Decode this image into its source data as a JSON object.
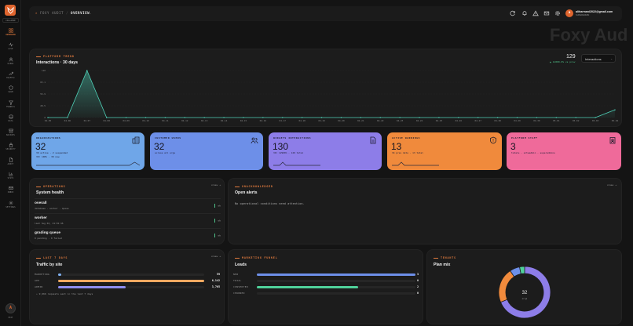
{
  "app": {
    "watermark": "Foxy Aud",
    "collapse_label": "COLLAPSE"
  },
  "sidebar": {
    "items": [
      {
        "label": "OVERVIEW",
        "icon": "grid-icon"
      },
      {
        "label": "LIVE",
        "icon": "pulse-icon"
      },
      {
        "label": "USERS",
        "icon": "user-icon"
      },
      {
        "label": "TRAFFIC",
        "icon": "trend-icon"
      },
      {
        "label": "SPAM",
        "icon": "shield-icon"
      },
      {
        "label": "FUNNELS",
        "icon": "funnel-icon"
      },
      {
        "label": "DATA",
        "icon": "database-icon"
      },
      {
        "label": "BACKUPS",
        "icon": "archive-icon"
      },
      {
        "label": "SECURITY",
        "icon": "lock-icon"
      },
      {
        "label": "AUDIT",
        "icon": "file-icon"
      },
      {
        "label": "STATS",
        "icon": "chart-icon"
      },
      {
        "label": "INBOX",
        "icon": "mail-icon"
      },
      {
        "label": "SETTINGS",
        "icon": "gear-icon"
      }
    ],
    "avatar_initial": "A",
    "exit_label": "EXIT"
  },
  "header": {
    "brand": "FOXY AUDIT",
    "current": "OVERVIEW",
    "user_initial": "a",
    "user_email": "aliharmani2022@gmail.com",
    "user_role": "SUPERADMIN"
  },
  "trend": {
    "eyebrow": "PLATFORM TREND",
    "title": "Interactions · 30 days",
    "total": "129",
    "delta": "▲ 11800.0% vs prev",
    "metric_select": "Interactions"
  },
  "chart_data": {
    "type": "line",
    "x": [
      "04-05",
      "04-06",
      "04-07",
      "04-08",
      "04-09",
      "04-10",
      "04-11",
      "04-12",
      "04-13",
      "04-14",
      "04-15",
      "04-16",
      "04-17",
      "04-18",
      "04-19",
      "04-20",
      "04-21",
      "04-22",
      "04-23",
      "04-24",
      "04-25",
      "04-26",
      "04-27",
      "04-28",
      "04-29",
      "04-30",
      "05-01",
      "05-02",
      "05-03",
      "05-04"
    ],
    "values": [
      0,
      0,
      110,
      0,
      0,
      0,
      0,
      0,
      0,
      0,
      0,
      0,
      0,
      0,
      0,
      0,
      0,
      0,
      0,
      0,
      0,
      0,
      0,
      0,
      0,
      0,
      0,
      0,
      0,
      18
    ],
    "yticks": [
      "0",
      "28.5",
      "55.9",
      "83.1",
      "110"
    ],
    "ylim": [
      0,
      110
    ],
    "grid": true,
    "color": "#4fd1b8"
  },
  "kpis": [
    {
      "label": "ORGANIZATIONS",
      "value": "32",
      "sub": "30 active · 2 suspended",
      "sub2": "30↑ 100% · 30 new",
      "color": "#6fa6e8",
      "icon": "buildings-icon"
    },
    {
      "label": "CUSTOMER USERS",
      "value": "32",
      "sub": "across all orgs",
      "color": "#6d8fe8",
      "icon": "users-icon"
    },
    {
      "label": "WIDGETS INTERACTIONS",
      "value": "130",
      "sub": "30↑ 12900% · 129 total",
      "color": "#8d7de8",
      "icon": "doc-icon"
    },
    {
      "label": "ACTIVE WARNINGS",
      "value": "13",
      "sub": "34 prev data · 13 total",
      "color": "#f08a3c",
      "icon": "shield-alert-icon"
    },
    {
      "label": "PLATFORM STAFF",
      "value": "3",
      "sub": "totals · siteadmin · superadmins",
      "color": "#ef6a9a",
      "icon": "badge-icon"
    }
  ],
  "operations": {
    "eyebrow": "OPERATIONS",
    "title": "System health",
    "view": "view →",
    "rows": [
      {
        "name": "overall",
        "detail": "database · worker · queue",
        "status": "ok"
      },
      {
        "name": "worker",
        "detail": "last hug 02, 21:01:16",
        "status": "ok"
      },
      {
        "name": "grading queue",
        "detail": "0 pending · 0 failed",
        "status": "ok"
      }
    ]
  },
  "acknowledged": {
    "eyebrow": "UNACKNOWLEDGED",
    "title": "Open alerts",
    "view": "view →",
    "empty": "No operational conditions need attention."
  },
  "traffic": {
    "eyebrow": "LAST 7 DAYS",
    "title": "Traffic by site",
    "view": "view →",
    "rows": [
      {
        "name": "MARKETING",
        "value": "59",
        "pct": 0.02,
        "color": "#7fb0f0"
      },
      {
        "name": "APP",
        "value": "6,142",
        "pct": 1.0,
        "color": "#f0a860"
      },
      {
        "name": "ADMIN",
        "value": "3,765",
        "pct": 0.46,
        "color": "#8d8df0"
      }
    ],
    "footer": "9,966 requests sent in the last 7 days"
  },
  "funnel": {
    "eyebrow": "MARKETING FUNNEL",
    "title": "Leads",
    "rows": [
      {
        "name": "NEW",
        "value": "3",
        "pct": 1.0,
        "color": "#6d8fe8"
      },
      {
        "name": "TRIAL",
        "value": "0",
        "pct": 0.0,
        "color": "#6d8fe8"
      },
      {
        "name": "CONVERTED",
        "value": "2",
        "pct": 0.64,
        "color": "#4fd19a"
      },
      {
        "name": "CHURNED",
        "value": "0",
        "pct": 0.0,
        "color": "#6d8fe8"
      }
    ]
  },
  "tenants": {
    "eyebrow": "TENANTS",
    "title": "Plan mix",
    "total": "32",
    "total_label": "orgs",
    "slices": [
      {
        "name": "free",
        "value": 22,
        "color": "#8d7de8"
      },
      {
        "name": "pro",
        "value": 7,
        "color": "#f08a3c"
      },
      {
        "name": "team",
        "value": 2,
        "color": "#6d8fe8"
      },
      {
        "name": "enterprise",
        "value": 1,
        "color": "#4fd19a"
      }
    ]
  }
}
